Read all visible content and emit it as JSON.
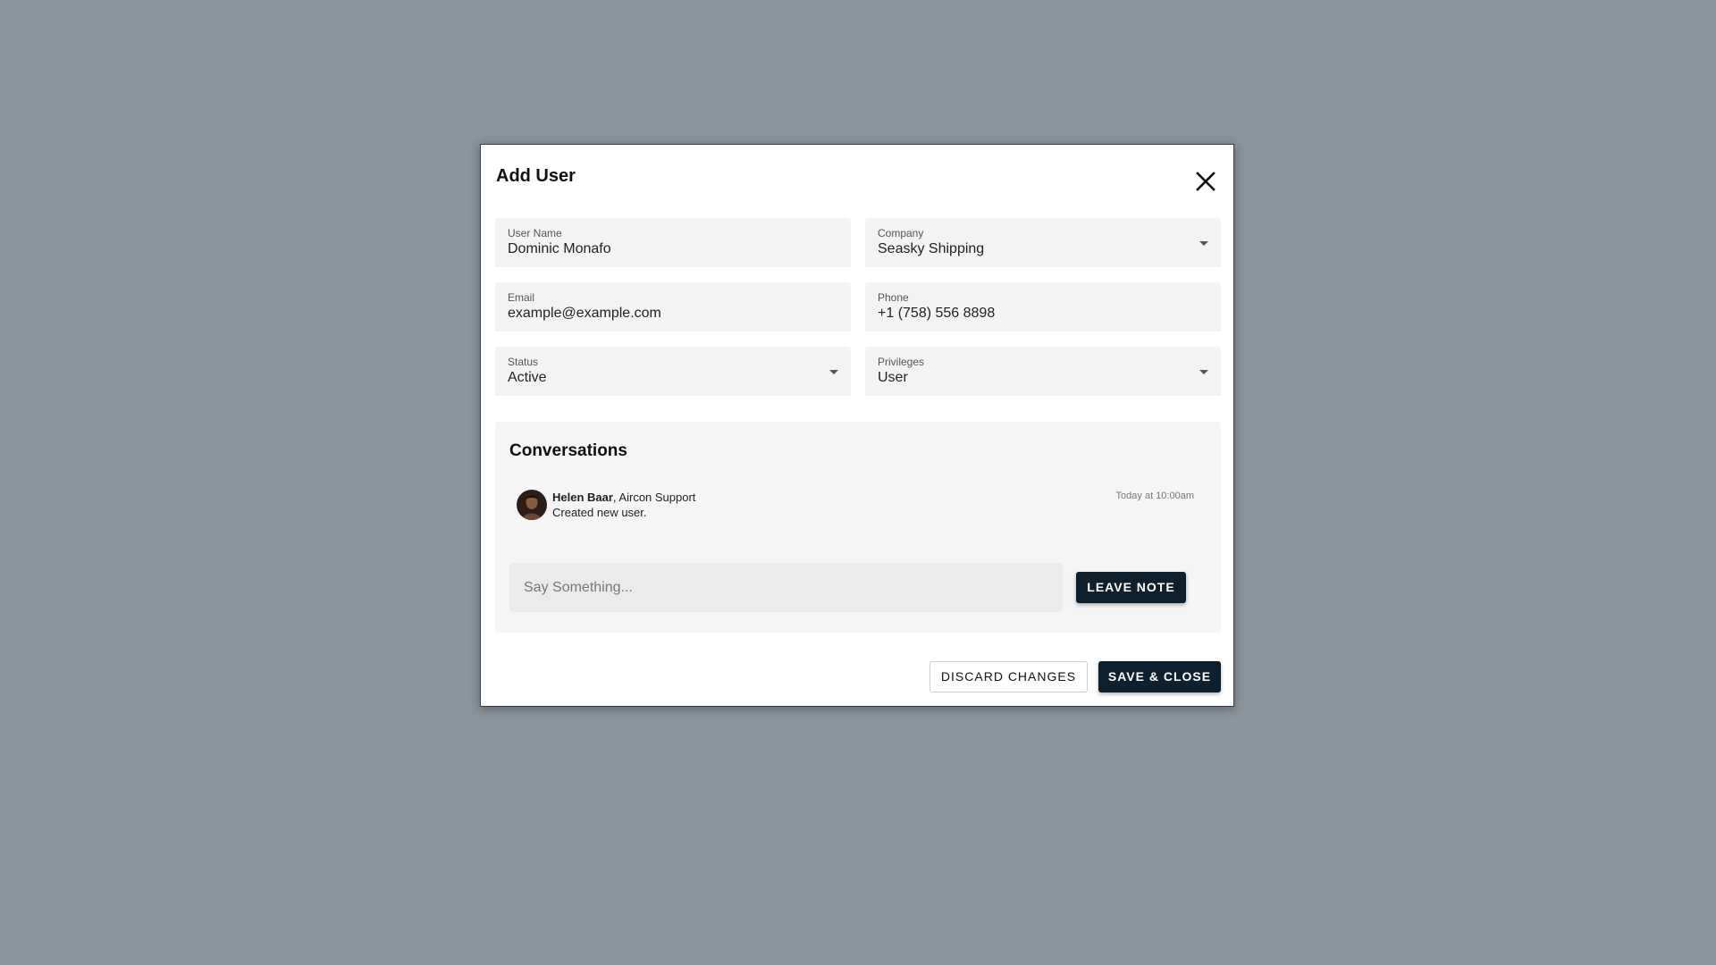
{
  "modal": {
    "title": "Add User"
  },
  "form": {
    "user_name": {
      "label": "User Name",
      "value": "Dominic Monafo"
    },
    "company": {
      "label": "Company",
      "value": "Seasky Shipping"
    },
    "email": {
      "label": "Email",
      "value": "example@example.com"
    },
    "phone": {
      "label": "Phone",
      "value": "+1 (758) 556 8898"
    },
    "status": {
      "label": "Status",
      "value": "Active"
    },
    "privileges": {
      "label": "Privileges",
      "value": "User"
    }
  },
  "conversations": {
    "title": "Conversations",
    "entries": [
      {
        "author": "Helen Baar",
        "role": ", Aircon Support",
        "message": "Created new user.",
        "time": "Today at 10:00am"
      }
    ],
    "note_placeholder": "Say Something...",
    "leave_note_label": "LEAVE NOTE"
  },
  "footer": {
    "discard_label": "DISCARD CHANGES",
    "save_label": "SAVE & CLOSE"
  },
  "colors": {
    "backdrop": "#8a949d",
    "primary_button": "#0e1f2d",
    "field_background": "#f3f3f3"
  },
  "icons": {
    "close": "close-icon",
    "dropdown": "chevron-down-icon"
  }
}
